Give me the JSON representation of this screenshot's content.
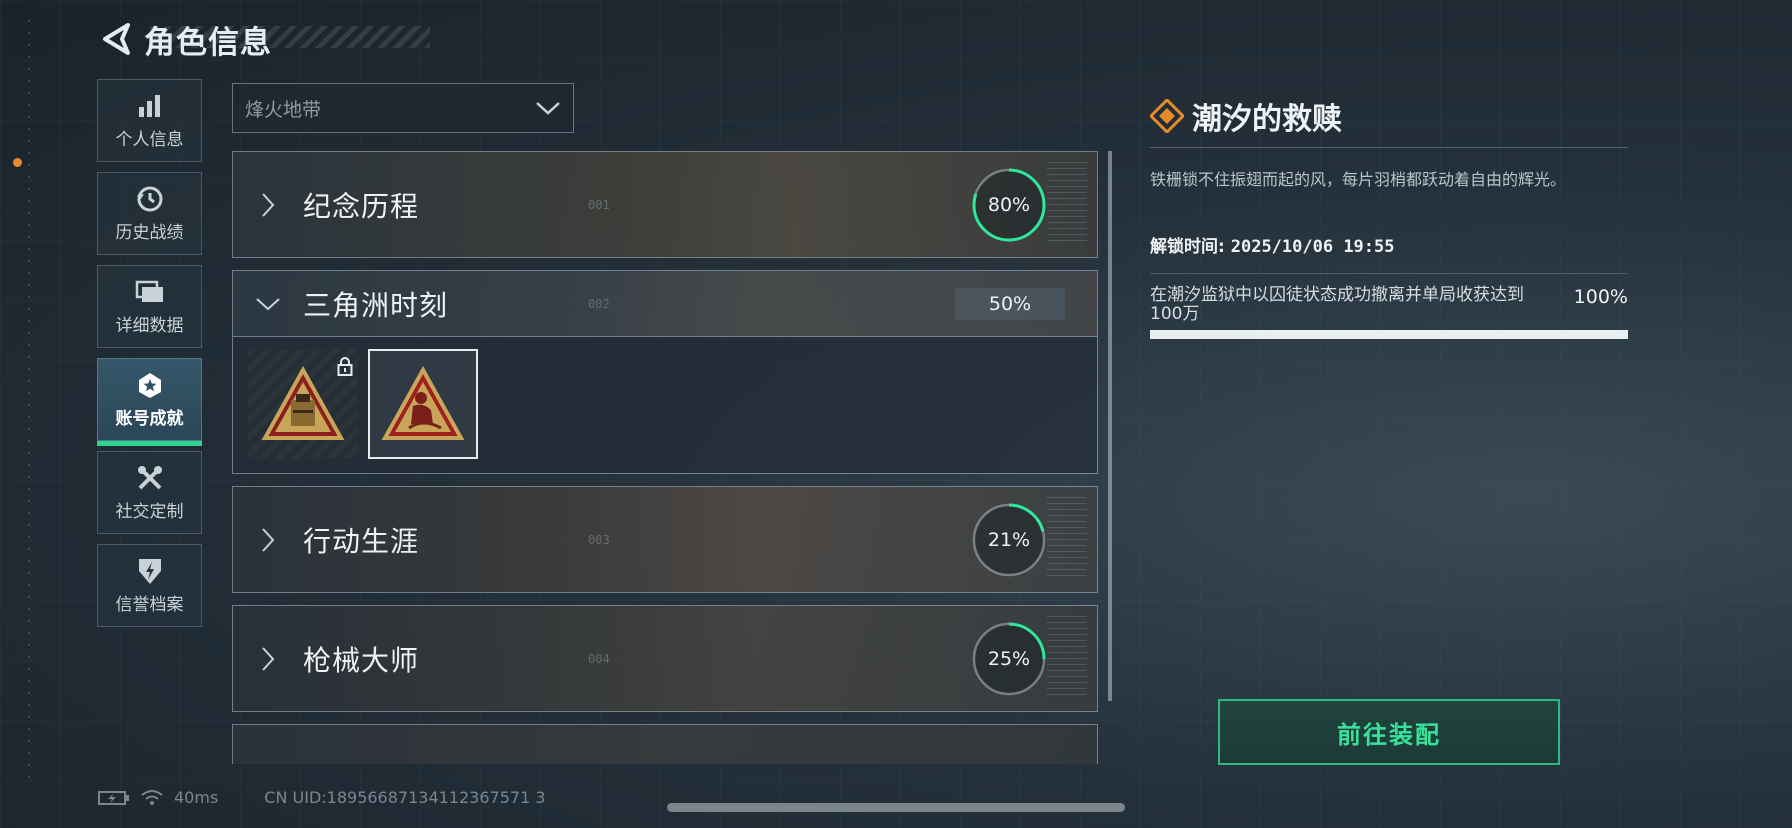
{
  "header": {
    "title": "角色信息"
  },
  "sidebar": {
    "items": [
      {
        "label": "个人信息",
        "icon": "bar-chart-icon"
      },
      {
        "label": "历史战绩",
        "icon": "history-icon"
      },
      {
        "label": "详细数据",
        "icon": "folder-icon"
      },
      {
        "label": "账号成就",
        "icon": "achievement-icon",
        "active": true
      },
      {
        "label": "社交定制",
        "icon": "tools-icon"
      },
      {
        "label": "信誉档案",
        "icon": "shield-icon"
      }
    ]
  },
  "mode_select": {
    "value": "烽火地带"
  },
  "categories": [
    {
      "name": "纪念历程",
      "ghost": "001",
      "progress_label": "80%",
      "progress": 0.8,
      "expanded": false
    },
    {
      "name": "三角洲时刻",
      "ghost": "002",
      "progress_label": "50%",
      "progress": 0.5,
      "expanded": true
    },
    {
      "name": "行动生涯",
      "ghost": "003",
      "progress_label": "21%",
      "progress": 0.21,
      "expanded": false
    },
    {
      "name": "枪械大师",
      "ghost": "004",
      "progress_label": "25%",
      "progress": 0.25,
      "expanded": false
    }
  ],
  "badges": [
    {
      "name": "crate-badge",
      "locked": true
    },
    {
      "name": "monkey-badge",
      "locked": false,
      "selected": true
    }
  ],
  "detail": {
    "title": "潮汐的救赎",
    "description": "铁栅锁不住振翅而起的风，每片羽梢都跃动着自由的辉光。",
    "unlock_label": "解锁时间:",
    "unlock_time": "2025/10/06 19:55",
    "condition": "在潮汐监狱中以囚徒状态成功撤离并单局收获达到100万",
    "condition_pct": "100%",
    "condition_progress": 1.0
  },
  "equip_button": {
    "label": "前往装配"
  },
  "footer": {
    "ping": "40ms",
    "uid": "CN UID:18956687134112367571 3"
  },
  "colors": {
    "accent_green": "#2fd58f",
    "ring_green": "#2fe89a",
    "orange": "#e68a2a"
  }
}
